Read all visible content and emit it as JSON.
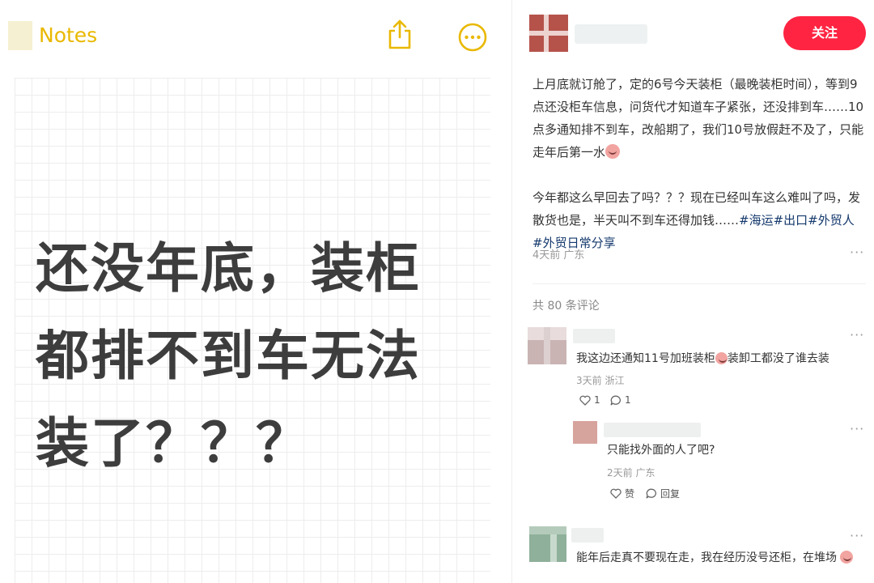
{
  "notes": {
    "title": "Notes",
    "icons": {
      "back": "back-block-icon",
      "share": "share-icon",
      "more": "more-icon"
    },
    "accent_color": "#e9b800",
    "lines": [
      "还没年底，装柜",
      "都排不到车无法",
      "装了？？？"
    ]
  },
  "post": {
    "follow_label": "关注",
    "follow_color": "#ff2442",
    "paragraph1": "上月底就订舱了，定的6号今天装柜（最晚装柜时间），等到9点还没柜车信息，问货代才知道车子紧张，还没排到车……10点多通知排不到车，改船期了，我们10号放假赶不及了，只能走年后第一水",
    "paragraph2_text": "今年都这么早回去了吗？？？现在已经叫车这么难叫了吗，发散货也是，半天叫不到车还得加钱……",
    "tags": [
      "#海运",
      "#出口",
      "#外贸人",
      "#外贸日常分享"
    ],
    "tag_color": "#13386c",
    "meta": "4天前 广东",
    "more": "···"
  },
  "comments": {
    "count_label": "共 80 条评论",
    "items": [
      {
        "text": "我这边还通知11号加班装柜",
        "text_after": "装卸工都没了谁去装",
        "meta": "3天前 浙江",
        "likes": "1",
        "replies": "1",
        "more": "···"
      },
      {
        "text": "只能找外面的人了吧?",
        "meta": "2天前 广东",
        "like_label": "赞",
        "reply_label": "回复",
        "more": "···"
      },
      {
        "text": "能年后走真不要现在走，我在经历没号还柜，在堆场",
        "more": "···"
      }
    ]
  }
}
